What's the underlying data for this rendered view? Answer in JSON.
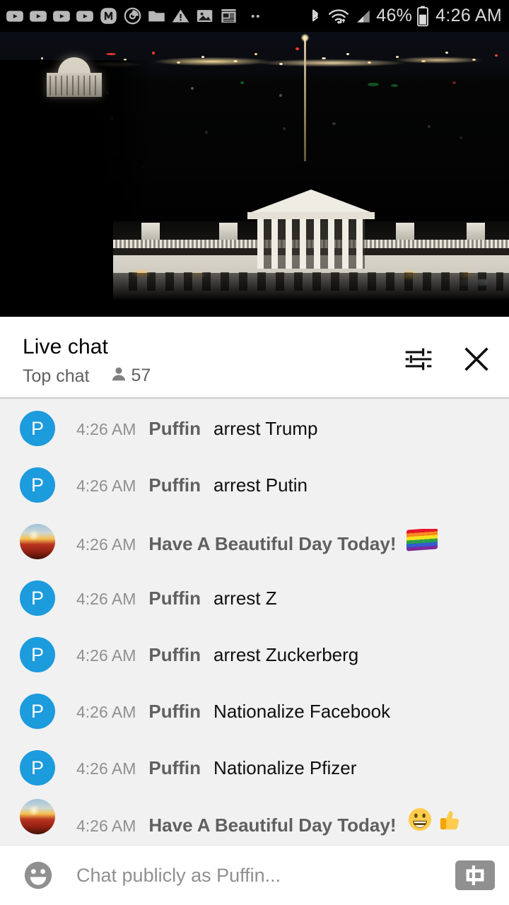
{
  "status_bar": {
    "icons": [
      "play-video-icon",
      "play-video-icon",
      "play-video-icon",
      "play-video-icon",
      "m-badge-icon",
      "power-timer-icon",
      "folder-icon",
      "warning-triangle-icon",
      "image-icon",
      "news-calendar-icon",
      "more-dots-icon"
    ],
    "bluetooth_icon": "bluetooth-icon",
    "wifi_icon": "wifi-icon",
    "signal_icon": "cellular-signal-icon",
    "battery_percent": "46%",
    "battery_icon": "battery-icon",
    "clock": "4:26 AM"
  },
  "video": {
    "name": "white-house-night-live-stream",
    "progress_color": "#e62117"
  },
  "chat_header": {
    "title": "Live chat",
    "mode": "Top chat",
    "viewer_icon": "person-icon",
    "viewer_count": "57",
    "settings_icon": "tune-sliders-icon",
    "close_icon": "close-x-icon"
  },
  "messages": [
    {
      "avatar_type": "letter",
      "avatar_letter": "P",
      "time": "4:26 AM",
      "author": "Puffin",
      "text": "arrest Trump",
      "emoji": ""
    },
    {
      "avatar_type": "letter",
      "avatar_letter": "P",
      "time": "4:26 AM",
      "author": "Puffin",
      "text": "arrest Putin",
      "emoji": ""
    },
    {
      "avatar_type": "photo",
      "avatar_letter": "",
      "time": "4:26 AM",
      "author": "Have A Beautiful Day Today!",
      "text": "",
      "emoji": "rainbow-flag"
    },
    {
      "avatar_type": "letter",
      "avatar_letter": "P",
      "time": "4:26 AM",
      "author": "Puffin",
      "text": "arrest Z",
      "emoji": ""
    },
    {
      "avatar_type": "letter",
      "avatar_letter": "P",
      "time": "4:26 AM",
      "author": "Puffin",
      "text": "arrest Zuckerberg",
      "emoji": ""
    },
    {
      "avatar_type": "letter",
      "avatar_letter": "P",
      "time": "4:26 AM",
      "author": "Puffin",
      "text": "Nationalize Facebook",
      "emoji": ""
    },
    {
      "avatar_type": "letter",
      "avatar_letter": "P",
      "time": "4:26 AM",
      "author": "Puffin",
      "text": "Nationalize Pfizer",
      "emoji": ""
    },
    {
      "avatar_type": "photo",
      "avatar_letter": "",
      "time": "4:26 AM",
      "author": "Have A Beautiful Day Today!",
      "text": "",
      "emoji": "grinning-thumbsup"
    }
  ],
  "input_bar": {
    "emoji_icon": "emoji-smiley-icon",
    "placeholder": "Chat publicly as Puffin...",
    "value": "",
    "superchat_icon": "dollar-superchat-icon"
  }
}
